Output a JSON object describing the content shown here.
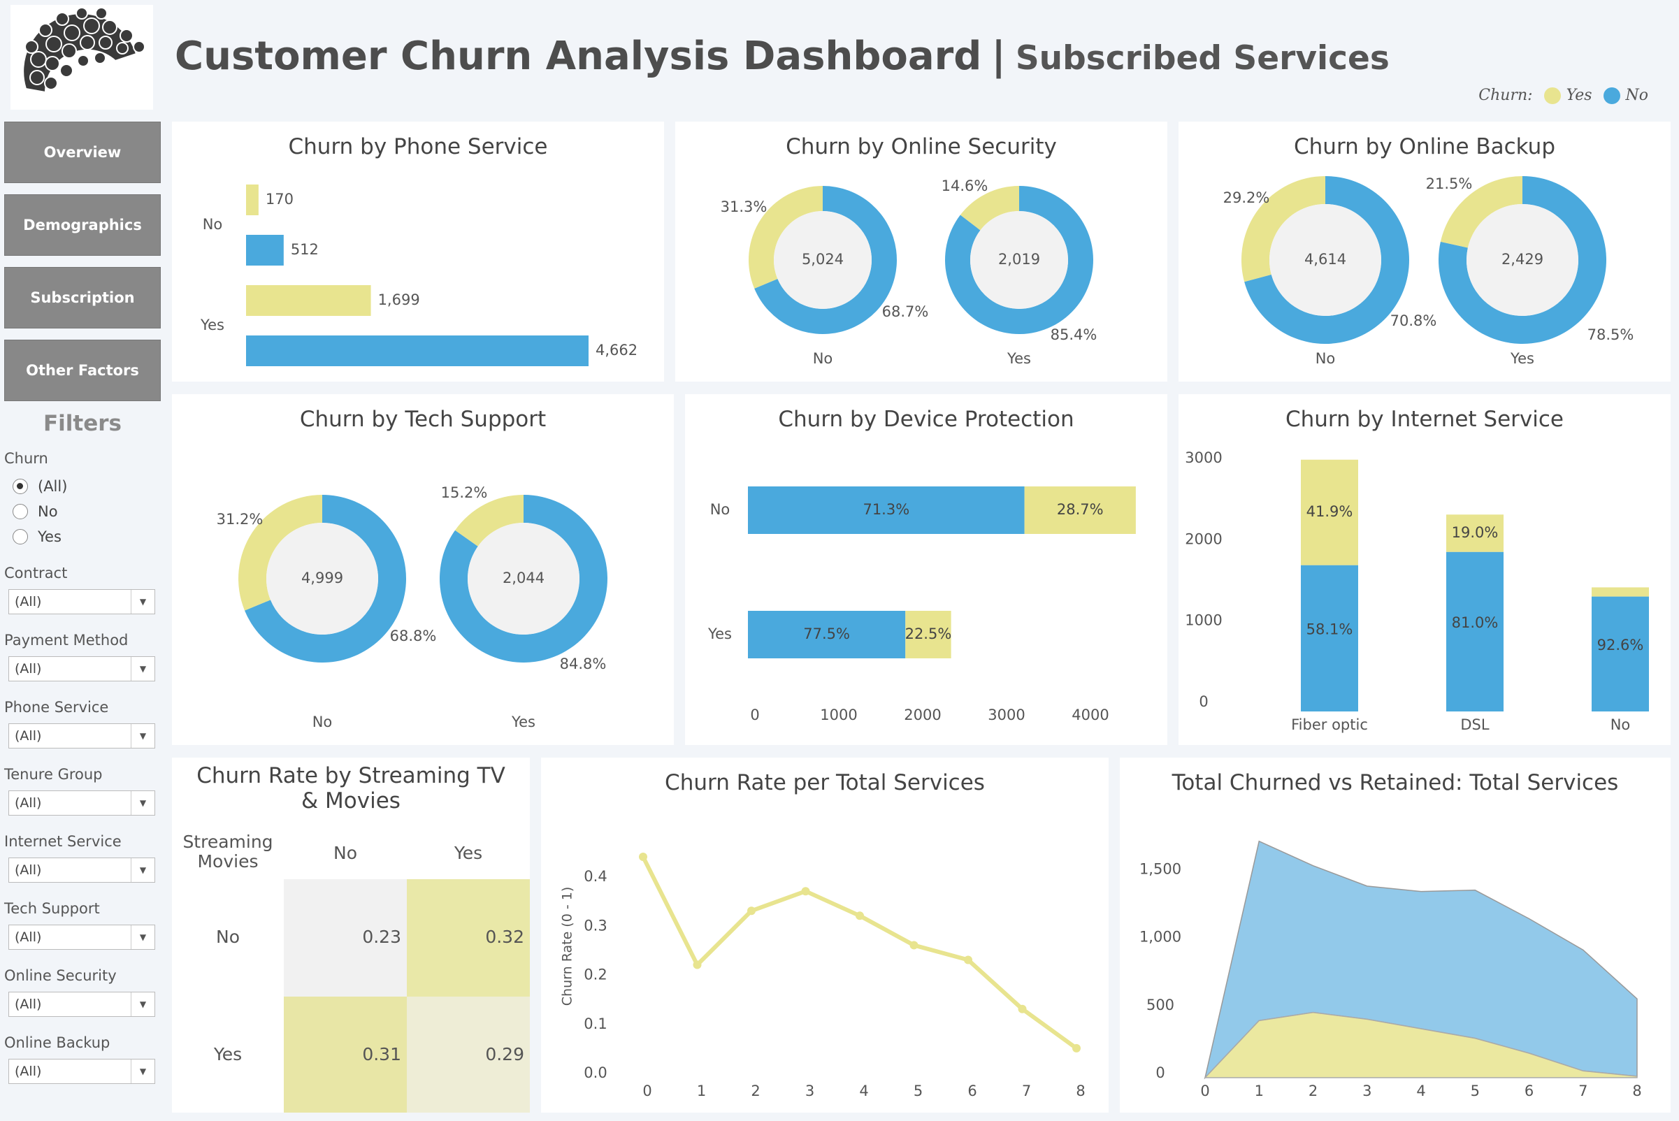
{
  "header": {
    "title": "Customer Churn Analysis Dashboard",
    "separator": "|",
    "subtitle": "Subscribed Services",
    "legend_label": "Churn:",
    "legend_yes": "Yes",
    "legend_no": "No"
  },
  "colors": {
    "yes": "#e8e48f",
    "no": "#4aa9dd",
    "area_no": "#92c9ea",
    "heat_high": "#e9e8a8",
    "heat_mid": "#e8e6a6",
    "heat_low": "#eeedd6",
    "heat_min": "#f1f1f1"
  },
  "nav": {
    "overview": "Overview",
    "demographics": "Demographics",
    "subscription": "Subscription",
    "other": "Other Factors"
  },
  "filters": {
    "title": "Filters",
    "churn_label": "Churn",
    "churn_options": [
      "(All)",
      "No",
      "Yes"
    ],
    "contract": {
      "label": "Contract",
      "value": "(All)"
    },
    "payment": {
      "label": "Payment Method",
      "value": "(All)"
    },
    "phone": {
      "label": "Phone Service",
      "value": "(All)"
    },
    "tenure": {
      "label": "Tenure Group",
      "value": "(All)"
    },
    "internet": {
      "label": "Internet Service",
      "value": "(All)"
    },
    "tech": {
      "label": "Tech Support",
      "value": "(All)"
    },
    "security": {
      "label": "Online Security",
      "value": "(All)"
    },
    "backup": {
      "label": "Online Backup",
      "value": "(All)"
    }
  },
  "chart_data": [
    {
      "id": "phone",
      "type": "bar",
      "title": "Churn by Phone Service",
      "orientation": "horizontal",
      "categories": [
        "No",
        "Yes"
      ],
      "series": [
        {
          "name": "Yes",
          "values": [
            170,
            1699
          ]
        },
        {
          "name": "No",
          "values": [
            512,
            4662
          ]
        }
      ],
      "labels": [
        "170",
        "512",
        "1,699",
        "4,662"
      ]
    },
    {
      "id": "security",
      "type": "pie",
      "title": "Churn by Online Security",
      "donuts": [
        {
          "category": "No",
          "total": "5,024",
          "yes_pct": 31.3,
          "no_pct": 68.7,
          "yes_label": "31.3%",
          "no_label": "68.7%"
        },
        {
          "category": "Yes",
          "total": "2,019",
          "yes_pct": 14.6,
          "no_pct": 85.4,
          "yes_label": "14.6%",
          "no_label": "85.4%"
        }
      ]
    },
    {
      "id": "backup",
      "type": "pie",
      "title": "Churn by Online Backup",
      "donuts": [
        {
          "category": "No",
          "total": "4,614",
          "yes_pct": 29.2,
          "no_pct": 70.8,
          "yes_label": "29.2%",
          "no_label": "70.8%"
        },
        {
          "category": "Yes",
          "total": "2,429",
          "yes_pct": 21.5,
          "no_pct": 78.5,
          "yes_label": "21.5%",
          "no_label": "78.5%"
        }
      ]
    },
    {
      "id": "tech",
      "type": "pie",
      "title": "Churn by Tech Support",
      "donuts": [
        {
          "category": "No",
          "total": "4,999",
          "yes_pct": 31.2,
          "no_pct": 68.8,
          "yes_label": "31.2%",
          "no_label": "68.8%"
        },
        {
          "category": "Yes",
          "total": "2,044",
          "yes_pct": 15.2,
          "no_pct": 84.8,
          "yes_label": "15.2%",
          "no_label": "84.8%"
        }
      ]
    },
    {
      "id": "device",
      "type": "bar",
      "title": "Churn by Device Protection",
      "orientation": "horizontal",
      "stacked": true,
      "categories": [
        "No",
        "Yes"
      ],
      "series": [
        {
          "name": "No",
          "values": [
            3297,
            1877
          ]
        },
        {
          "name": "Yes",
          "values": [
            1327,
            545
          ]
        }
      ],
      "pct_labels": [
        [
          "71.3%",
          "28.7%"
        ],
        [
          "77.5%",
          "22.5%"
        ]
      ],
      "xlim": [
        0,
        4700
      ],
      "xticks": [
        "0",
        "1000",
        "2000",
        "3000",
        "4000"
      ]
    },
    {
      "id": "internet",
      "type": "bar",
      "title": "Churn by Internet Service",
      "stacked": true,
      "categories": [
        "Fiber optic",
        "DSL",
        "No"
      ],
      "series": [
        {
          "name": "No",
          "values": [
            1799,
            1962,
            1413
          ]
        },
        {
          "name": "Yes",
          "values": [
            1297,
            459,
            113
          ]
        }
      ],
      "pct_labels": [
        [
          "58.1%",
          "41.9%"
        ],
        [
          "81.0%",
          "19.0%"
        ],
        [
          "92.6%",
          ""
        ]
      ],
      "ylim": [
        0,
        3200
      ],
      "yticks": [
        "0",
        "1000",
        "2000",
        "3000"
      ]
    },
    {
      "id": "heatmap",
      "type": "heatmap",
      "title": "Churn Rate by Streaming TV & Movies",
      "row_header": "Streaming Movies",
      "cols": [
        "No",
        "Yes"
      ],
      "rows": [
        "No",
        "Yes"
      ],
      "values": [
        [
          "0.23",
          "0.32"
        ],
        [
          "0.31",
          "0.29"
        ]
      ]
    },
    {
      "id": "rate",
      "type": "line",
      "title": "Churn Rate per Total Services",
      "ylabel": "Churn Rate (0 - 1)",
      "x": [
        0,
        1,
        2,
        3,
        4,
        5,
        6,
        7,
        8
      ],
      "values": [
        0.43,
        0.21,
        0.32,
        0.36,
        0.31,
        0.25,
        0.22,
        0.12,
        0.04
      ],
      "ylim": [
        0,
        0.45
      ],
      "yticks": [
        "0.0",
        "0.1",
        "0.2",
        "0.3",
        "0.4"
      ]
    },
    {
      "id": "area",
      "type": "area",
      "title": "Total Churned vs Retained: Total Services",
      "x": [
        0,
        1,
        2,
        3,
        4,
        5,
        6,
        7,
        8
      ],
      "series": [
        {
          "name": "Yes",
          "values": [
            0,
            420,
            480,
            430,
            360,
            290,
            180,
            50,
            10
          ]
        },
        {
          "name": "No",
          "values": [
            0,
            1320,
            1080,
            980,
            1010,
            1090,
            990,
            890,
            570
          ]
        }
      ],
      "ylim": [
        0,
        1800
      ],
      "yticks": [
        "0",
        "500",
        "1,000",
        "1,500"
      ]
    }
  ]
}
